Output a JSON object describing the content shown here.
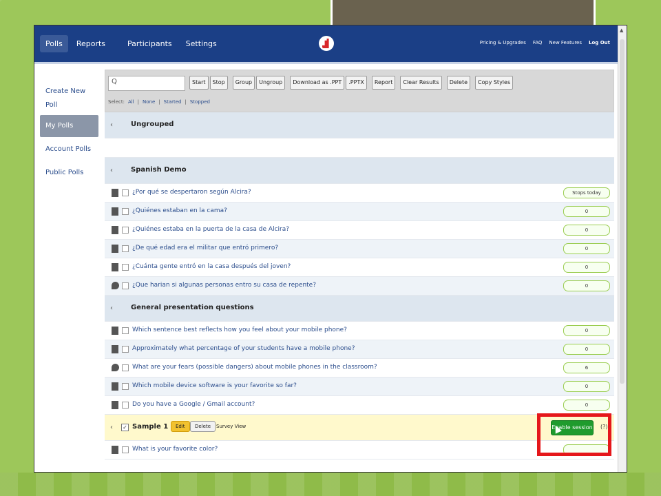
{
  "nav": {
    "tabs": [
      "Polls",
      "Reports",
      "Participants",
      "Settings"
    ],
    "right": [
      "Pricing & Upgrades",
      "FAQ",
      "New Features",
      "Log Out"
    ]
  },
  "sidebar": {
    "items": [
      "Create New Poll",
      "My Polls",
      "Account Polls",
      "Public Polls"
    ]
  },
  "toolbar": {
    "search_icon": "Q",
    "buttons": [
      "Start",
      "Stop",
      "Group",
      "Ungroup",
      "Download as .PPT",
      ".PPTX",
      "Report",
      "Clear Results",
      "Delete",
      "Copy Styles"
    ],
    "select_label": "Select:",
    "select_links": [
      "All",
      "None",
      "Started",
      "Stopped"
    ]
  },
  "groups": [
    {
      "title": "Ungrouped",
      "polls": []
    },
    {
      "title": "Spanish Demo",
      "polls": [
        {
          "q": "¿Por qué se despertaron según Alcira?",
          "status": "Stops today",
          "icon": "multiple-choice-icon"
        },
        {
          "q": "¿Quiénes estaban en la cama?",
          "status": "0",
          "icon": "multiple-choice-icon"
        },
        {
          "q": "¿Quiénes estaba en la puerta de la casa de Alcira?",
          "status": "0",
          "icon": "multiple-choice-icon"
        },
        {
          "q": "¿De qué edad era el militar que  entró primero?",
          "status": "0",
          "icon": "multiple-choice-icon"
        },
        {
          "q": "¿Cuánta gente entró en la casa después del joven?",
          "status": "0",
          "icon": "multiple-choice-icon"
        },
        {
          "q": "¿Que harian si algunas personas entro su casa de repente?",
          "status": "0",
          "icon": "open-ended-icon"
        }
      ]
    },
    {
      "title": "General presentation questions",
      "polls": [
        {
          "q": "Which sentence best reflects how you feel about your mobile phone?",
          "status": "0",
          "icon": "multiple-choice-icon"
        },
        {
          "q": "Approximately what percentage of your students have a mobile phone?",
          "status": "0",
          "icon": "multiple-choice-icon"
        },
        {
          "q": "What are your fears (possible dangers) about mobile phones in the classroom?",
          "status": "6",
          "icon": "open-ended-icon"
        },
        {
          "q": "Which mobile device software is your favorite so far?",
          "status": "0",
          "icon": "multiple-choice-icon"
        },
        {
          "q": "Do you have a Google / Gmail account?",
          "status": "0",
          "icon": "multiple-choice-icon"
        }
      ]
    }
  ],
  "sample": {
    "title": "Sample 1",
    "edit": "Edit",
    "delete": "Delete",
    "survey_view": "Survey View",
    "enable": "Enable session",
    "help": "(?)",
    "polls": [
      {
        "q": "What is your favorite color?",
        "status": "",
        "icon": "multiple-choice-icon"
      }
    ]
  },
  "colors": {
    "nav_bg": "#1b3f86",
    "highlight": "#e5171b",
    "enable_btn": "#1f9b2d",
    "pill_border": "#9acd50"
  }
}
